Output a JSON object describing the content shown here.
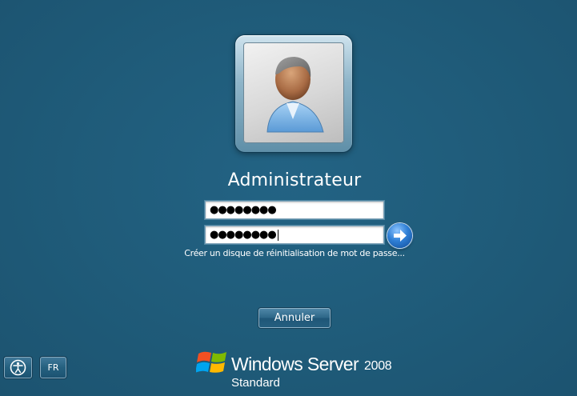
{
  "login": {
    "username": "Administrateur",
    "password_masked": "●●●●●●●●",
    "confirm_masked": "●●●●●●●●",
    "reset_link": "Créer un disque de réinitialisation de mot de passe...",
    "cancel_label": "Annuler"
  },
  "bottom_bar": {
    "ease_of_access_icon": "ease-of-access-icon",
    "language_label": "FR"
  },
  "branding": {
    "product_name": "Windows Server",
    "version": "2008",
    "edition": "Standard"
  },
  "colors": {
    "background": "#1f5a78",
    "go_button": "#2f7fd6"
  }
}
